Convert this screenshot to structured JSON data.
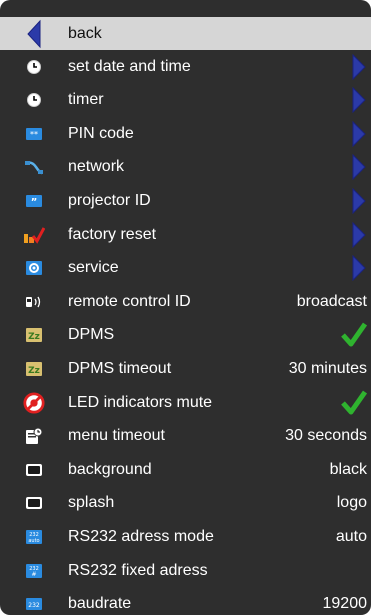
{
  "menu": {
    "back_label": "back",
    "items": [
      {
        "label": "set date and time",
        "icon": "clock-icon",
        "value": "",
        "arrow": true
      },
      {
        "label": "timer",
        "icon": "clock-icon",
        "value": "",
        "arrow": true
      },
      {
        "label": "PIN code",
        "icon": "pin-keypad-icon",
        "value": "",
        "arrow": true
      },
      {
        "label": "network",
        "icon": "network-cable-icon",
        "value": "",
        "arrow": true
      },
      {
        "label": "projector ID",
        "icon": "id-quote-icon",
        "value": "",
        "arrow": true
      },
      {
        "label": "factory reset",
        "icon": "factory-reset-icon",
        "value": "",
        "arrow": true
      },
      {
        "label": "service",
        "icon": "service-icon",
        "value": "",
        "arrow": true
      },
      {
        "label": "remote control ID",
        "icon": "remote-signal-icon",
        "value": "broadcast",
        "arrow": false
      },
      {
        "label": "DPMS",
        "icon": "sleep-zz-icon",
        "value": "",
        "check": true
      },
      {
        "label": "DPMS timeout",
        "icon": "sleep-zz-icon",
        "value": "30 minutes",
        "arrow": false
      },
      {
        "label": "LED indicators mute",
        "icon": "led-mute-icon",
        "value": "",
        "check": true
      },
      {
        "label": "menu timeout",
        "icon": "menu-timer-icon",
        "value": "30 seconds",
        "arrow": false
      },
      {
        "label": "background",
        "icon": "screen-icon",
        "value": "black",
        "arrow": false
      },
      {
        "label": "splash",
        "icon": "screen-icon",
        "value": "logo",
        "arrow": false
      },
      {
        "label": "RS232 adress mode",
        "icon": "rs232-auto-icon",
        "value": "auto",
        "arrow": false
      },
      {
        "label": "RS232 fixed adress",
        "icon": "rs232-fixed-icon",
        "value": "",
        "arrow": false
      },
      {
        "label": "baudrate",
        "icon": "rs232-baud-icon",
        "value": "19200",
        "arrow": false
      }
    ]
  },
  "colors": {
    "panel": "#2e2e2e",
    "back_bar": "#d6d6d6",
    "arrow_blue": "#2b3aa8",
    "check_green": "#2fb32f"
  }
}
